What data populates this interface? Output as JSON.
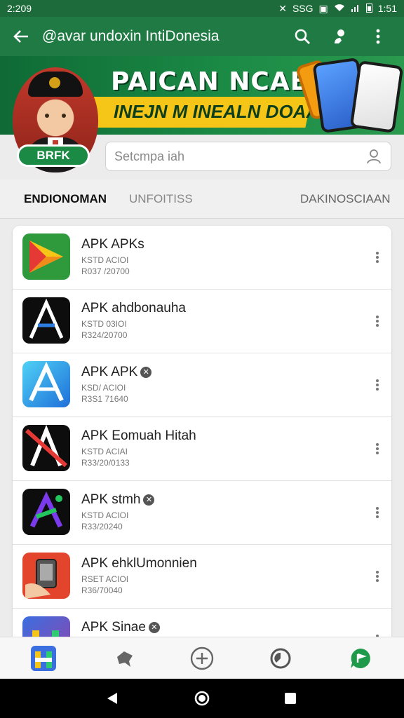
{
  "status_bar": {
    "time": "2:209",
    "right_time": "1:51",
    "signal_label": "SSG"
  },
  "app_bar": {
    "title": "@avar undoxin IntiDonesia",
    "back_icon": "arrow-left-icon",
    "search_icon": "search-icon",
    "mic_icon": "microphone-icon",
    "menu_icon": "more-vertical-icon"
  },
  "banner": {
    "line1": "PAICAN NCABIINI",
    "line2": "INEJN M INEALN DOAAA"
  },
  "brand": {
    "label": "BRFK"
  },
  "search": {
    "placeholder": "Setcmpa iah",
    "icon": "search-person-icon"
  },
  "tabs": [
    {
      "label": "ENDIONOMAN",
      "active": true
    },
    {
      "label": "UNFOITISS",
      "active": false
    },
    {
      "label": "DAKINOSCIAAN",
      "active": false
    }
  ],
  "apps": [
    {
      "name": "APK APKs",
      "line1": "KSTD ACIOI",
      "line2": "R037 /20700",
      "verified": false,
      "icon": "play-triangle-icon"
    },
    {
      "name": "APK ahdbonauha",
      "line1": "KSTD 03IOI",
      "line2": "R324/20700",
      "verified": false,
      "icon": "letter-a-dark-icon"
    },
    {
      "name": "APK APK",
      "line1": "KSD/ ACIOI",
      "line2": "R3S1 71640",
      "verified": true,
      "icon": "letter-a-blue-icon"
    },
    {
      "name": "APK Eomuah Hitah",
      "line1": "KSTD ACIAI",
      "line2": "R33/20/0133",
      "verified": false,
      "icon": "letter-a-red-icon"
    },
    {
      "name": "APK stmh",
      "line1": "KSTD ACIOI",
      "line2": "R33/20240",
      "verified": true,
      "icon": "letter-a-gradient-icon"
    },
    {
      "name": "APK ehklUmonnien",
      "line1": "RSET ACIOI",
      "line2": "R36/70040",
      "verified": false,
      "icon": "phone-hand-icon"
    },
    {
      "name": "APK Sinae",
      "line1": "",
      "line2": "",
      "verified": true,
      "icon": "letter-h-icon"
    }
  ],
  "verified_glyph": "✕",
  "bottom_nav": [
    {
      "icon": "home-app-icon"
    },
    {
      "icon": "map-tag-icon"
    },
    {
      "icon": "add-circle-icon"
    },
    {
      "icon": "history-icon"
    },
    {
      "icon": "chat-bubble-icon"
    }
  ],
  "colors": {
    "primary": "#1f7a43",
    "status": "#1d6b3a",
    "accent_yellow": "#f5c518"
  }
}
